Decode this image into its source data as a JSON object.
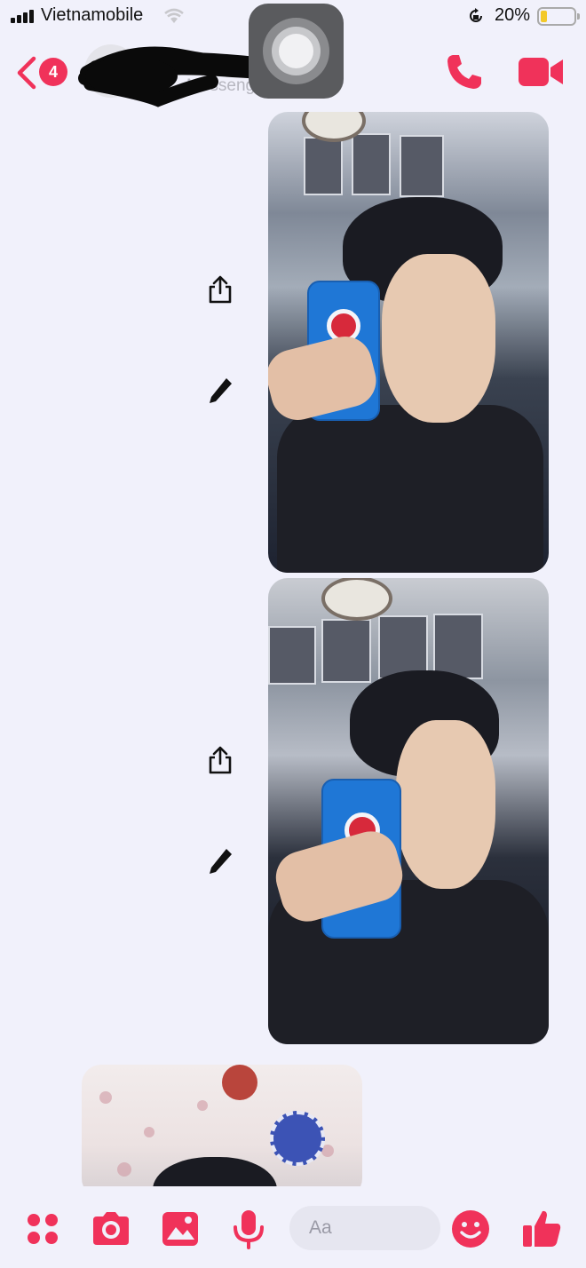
{
  "status_bar": {
    "carrier": "Vietnamobile",
    "battery_percent": "20%",
    "battery_level": 0.2,
    "signal_icon": "signal-bars-icon",
    "wifi_icon": "wifi-icon",
    "rotation_lock_icon": "rotation-lock-icon"
  },
  "header": {
    "back_badge": "4",
    "contact_name": "",
    "contact_subtitle": "Messenger",
    "call_icon": "phone-icon",
    "video_icon": "video-camera-icon"
  },
  "messages": [
    {
      "type": "photo",
      "sender": "self"
    },
    {
      "type": "photo",
      "sender": "self"
    },
    {
      "type": "photo",
      "sender": "other"
    }
  ],
  "message_actions": [
    "share-icon",
    "edit-pencil-icon"
  ],
  "composer": {
    "placeholder": "Aa",
    "tools": [
      "apps-grid-icon",
      "camera-icon",
      "gallery-icon",
      "microphone-icon"
    ],
    "emoji_icon": "emoji-icon",
    "like_icon": "thumbs-up-icon"
  },
  "colors": {
    "accent": "#f0325a",
    "background": "#f1f1fb"
  }
}
